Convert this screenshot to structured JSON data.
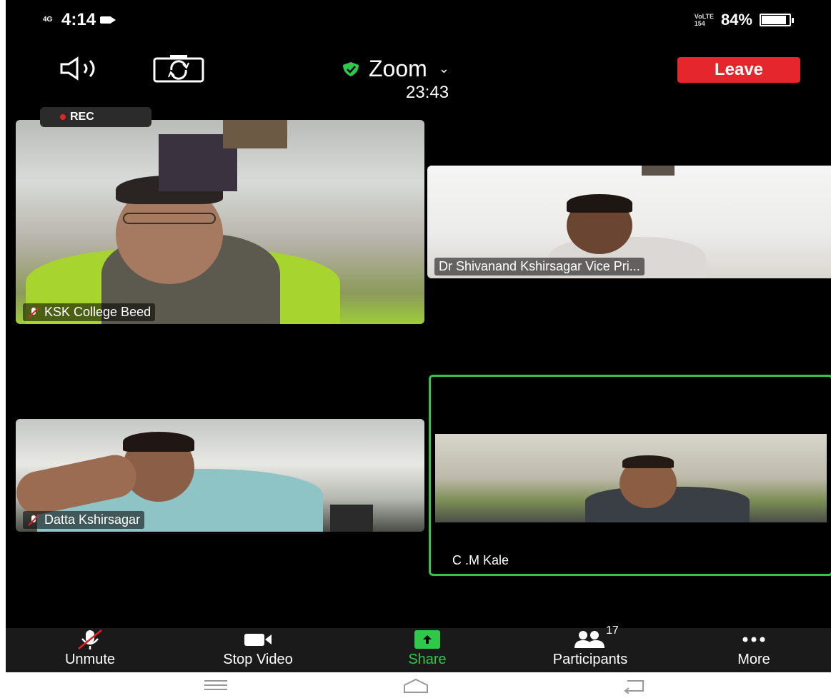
{
  "status_bar": {
    "network": "4G",
    "time": "4:14",
    "lte": "VoLTE",
    "speed": "154",
    "battery": "84%"
  },
  "top_bar": {
    "title": "Zoom",
    "timer": "23:43",
    "leave_label": "Leave",
    "leave_color": "#e5262c"
  },
  "recording_badge": "REC",
  "participants_video": [
    {
      "name": "KSK College Beed",
      "muted": true
    },
    {
      "name": "Dr Shivanand Kshirsagar Vice Pri...",
      "muted": false
    },
    {
      "name": "Datta Kshirsagar",
      "muted": true
    },
    {
      "name": "C .M Kale",
      "muted": false,
      "active_speaker": true
    }
  ],
  "toolbar": {
    "unmute_label": "Unmute",
    "stop_video_label": "Stop Video",
    "share_label": "Share",
    "participants_label": "Participants",
    "participants_count": "17",
    "more_label": "More",
    "accent_color": "#2ec84a"
  },
  "icons": {
    "speaker": "speaker-icon",
    "flip": "flip-camera-icon",
    "shield": "shield-icon",
    "mic_off": "mic-off-icon",
    "video": "video-camera-icon",
    "share": "share-arrow-icon",
    "participants": "participants-icon",
    "more": "more-dots-icon"
  }
}
